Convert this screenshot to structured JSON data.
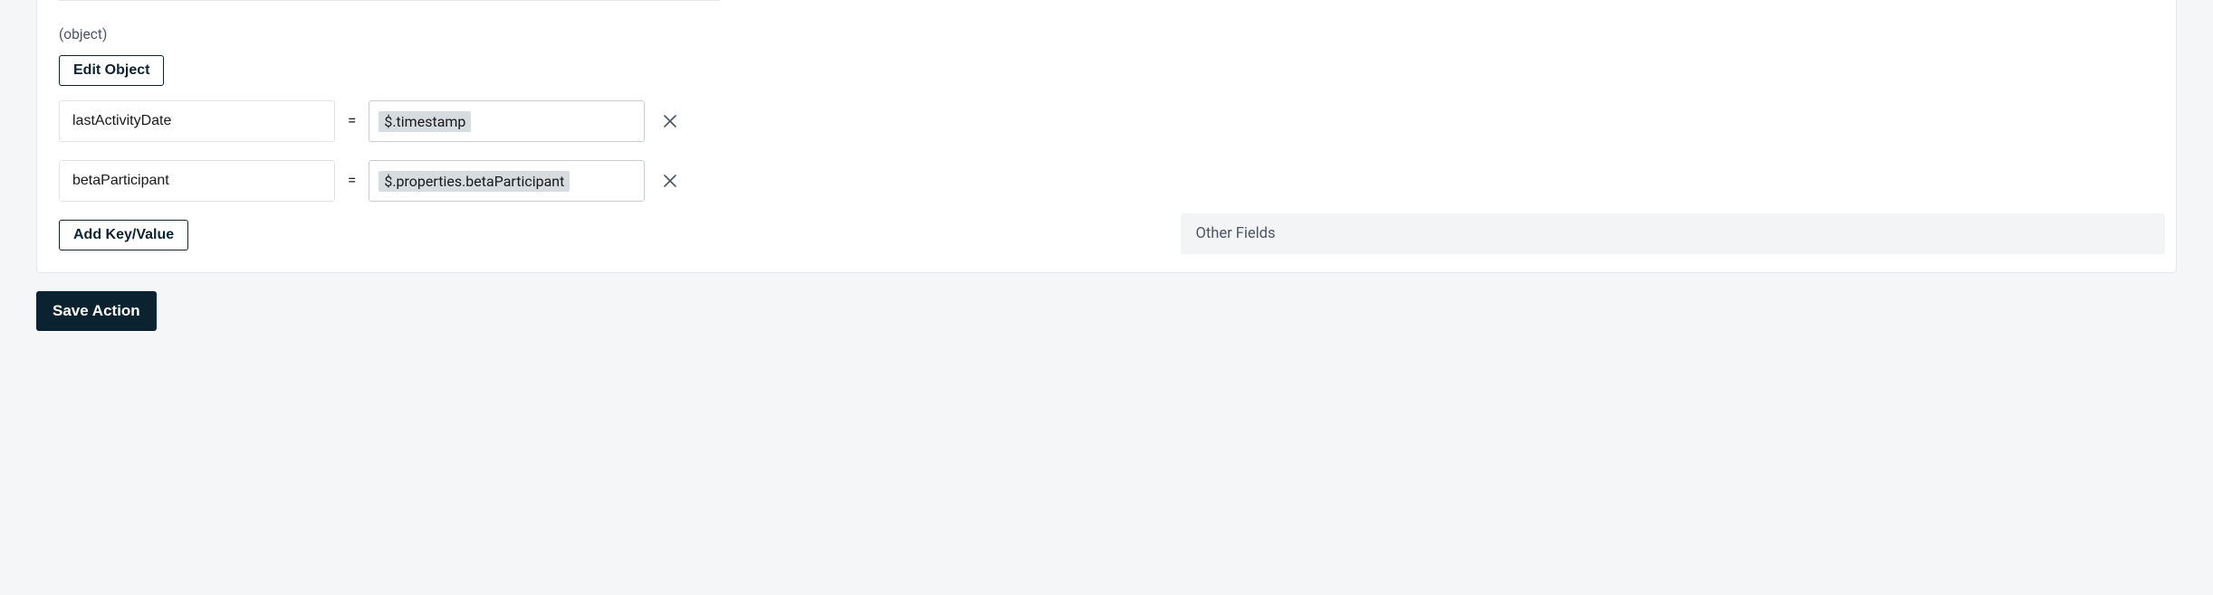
{
  "objectEditor": {
    "typeLabel": "(object)",
    "editButtonLabel": "Edit Object",
    "rows": [
      {
        "key": "lastActivityDate",
        "value": "$.timestamp"
      },
      {
        "key": "betaParticipant",
        "value": "$.properties.betaParticipant"
      }
    ],
    "addButtonLabel": "Add Key/Value"
  },
  "sidePanel": {
    "title": "Other Fields"
  },
  "footer": {
    "saveButtonLabel": "Save Action"
  }
}
